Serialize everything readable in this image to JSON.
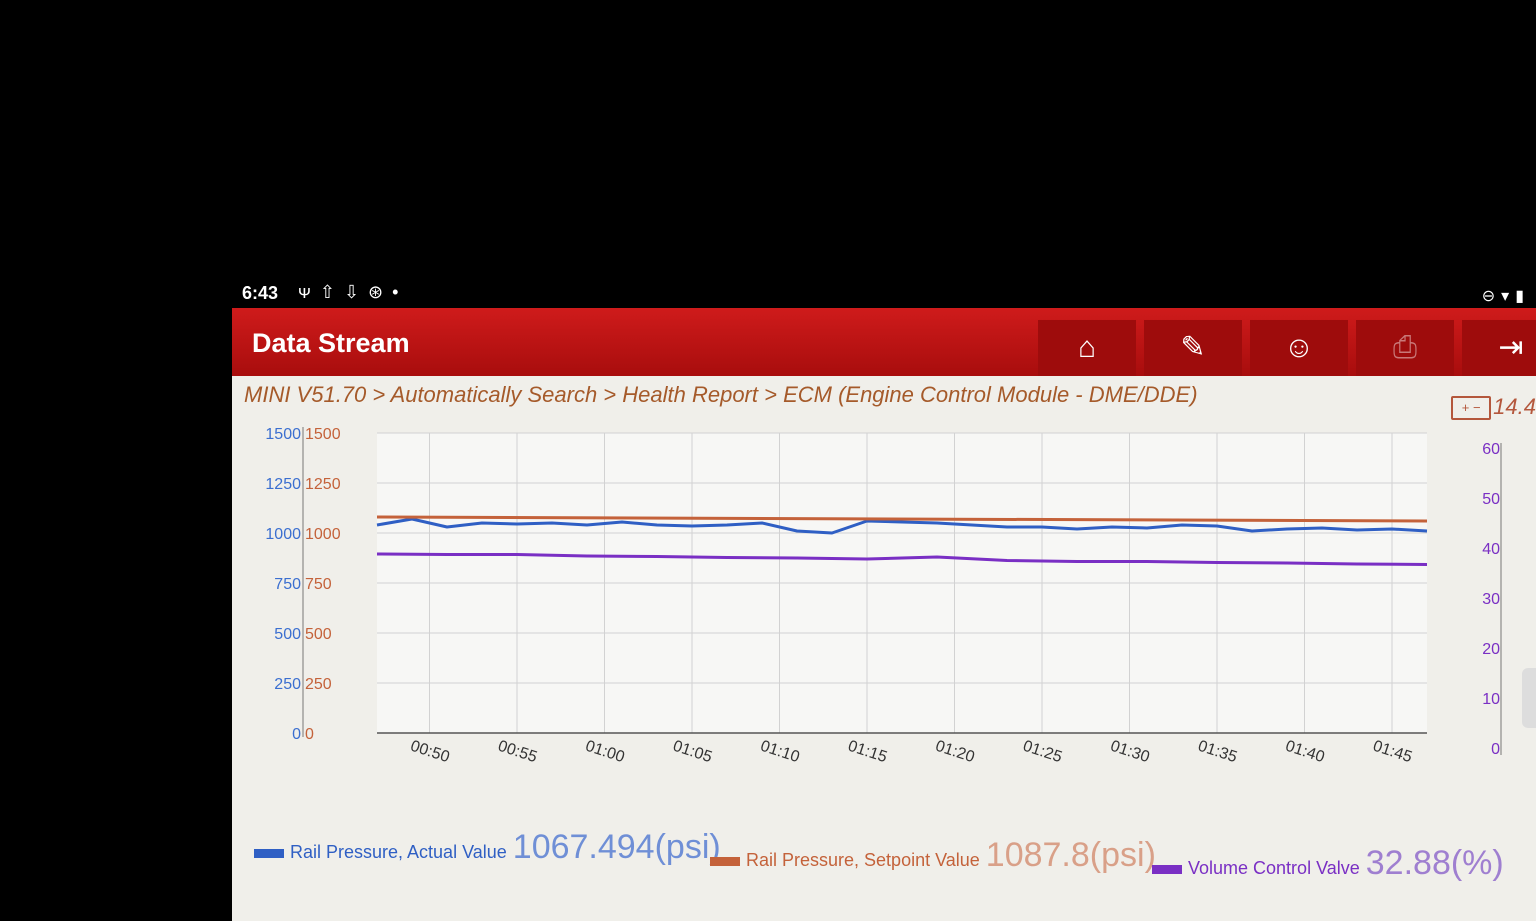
{
  "status_bar": {
    "time": "6:43",
    "icons_left": [
      "usb-debug-icon",
      "upload-icon",
      "download-icon",
      "vci-icon",
      "dot-icon"
    ],
    "icons_right": [
      "do-not-disturb-icon",
      "wifi-icon",
      "battery-icon"
    ]
  },
  "header": {
    "title": "Data Stream",
    "buttons": [
      {
        "name": "home-button",
        "icon": "⌂"
      },
      {
        "name": "edit-report-button",
        "icon": "✎"
      },
      {
        "name": "remote-support-button",
        "icon": "☺"
      },
      {
        "name": "print-button",
        "icon": "⎙"
      },
      {
        "name": "exit-button",
        "icon": "⇥"
      }
    ]
  },
  "breadcrumb": "MINI V51.70 > Automatically Search > Health Report > ECM (Engine Control Module - DME/DDE)",
  "battery_voltage": "14.4",
  "battery_symbol": "+ −",
  "legend": [
    {
      "name": "Rail Pressure, Actual Value",
      "value": "1067.494(psi)",
      "color": "#2f5fc4"
    },
    {
      "name": "Rail Pressure, Setpoint Value",
      "value": "1087.8(psi)",
      "color": "#c4623a"
    },
    {
      "name": "Volume Control Valve",
      "value": "32.88(%)",
      "color": "#7a2fc4"
    }
  ],
  "chart_data": {
    "type": "line",
    "x_tick_labels": [
      "00:50",
      "00:55",
      "01:00",
      "01:05",
      "01:10",
      "01:15",
      "01:20",
      "01:25",
      "01:30",
      "01:35",
      "01:40",
      "01:45"
    ],
    "x_range_seconds": [
      47,
      107
    ],
    "left_axis_ticks": [
      0,
      250,
      500,
      750,
      1000,
      1250,
      1500
    ],
    "left_axis_range": [
      0,
      1500
    ],
    "right_axis_ticks": [
      0,
      10,
      20,
      30,
      40,
      50,
      60
    ],
    "right_axis_range": [
      0,
      60
    ],
    "grid": true,
    "series": [
      {
        "name": "Rail Pressure, Actual Value",
        "axis": "left",
        "color": "#2f5fc4",
        "x": [
          47,
          49,
          51,
          53,
          55,
          57,
          59,
          61,
          63,
          65,
          67,
          69,
          71,
          73,
          75,
          77,
          79,
          81,
          83,
          85,
          87,
          89,
          91,
          93,
          95,
          97,
          99,
          101,
          103,
          105,
          107
        ],
        "values": [
          1040,
          1070,
          1030,
          1050,
          1045,
          1050,
          1040,
          1055,
          1040,
          1035,
          1040,
          1050,
          1010,
          1000,
          1060,
          1055,
          1050,
          1040,
          1030,
          1030,
          1020,
          1030,
          1025,
          1040,
          1035,
          1010,
          1020,
          1025,
          1015,
          1020,
          1010
        ]
      },
      {
        "name": "Rail Pressure, Setpoint Value",
        "axis": "left",
        "color": "#c4623a",
        "x": [
          47,
          107
        ],
        "values": [
          1080,
          1060
        ]
      },
      {
        "name": "Volume Control Valve",
        "axis": "right",
        "color": "#7a2fc4",
        "x": [
          47,
          51,
          55,
          59,
          63,
          67,
          71,
          75,
          79,
          83,
          87,
          91,
          95,
          99,
          103,
          107
        ],
        "values": [
          35.8,
          35.7,
          35.7,
          35.4,
          35.3,
          35.1,
          35.0,
          34.8,
          35.2,
          34.5,
          34.3,
          34.3,
          34.1,
          34.0,
          33.8,
          33.7
        ]
      }
    ]
  }
}
